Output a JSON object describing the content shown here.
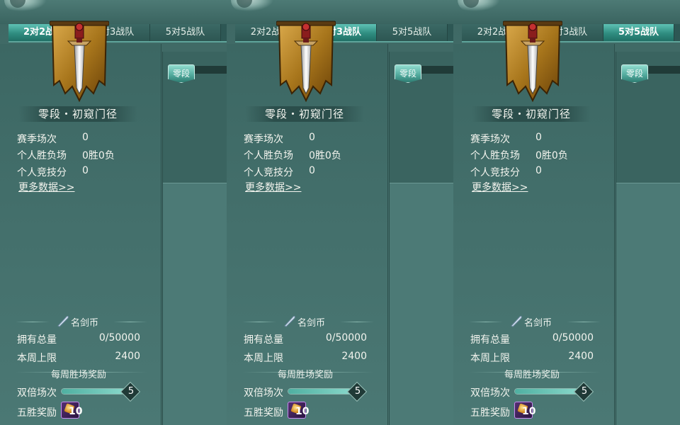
{
  "tabs": [
    "2对2战队",
    "3对3战队",
    "5对5战队"
  ],
  "panels": [
    {
      "active_tab": 0,
      "rank_badge": "零段",
      "rank_title": "零段・初窥门径",
      "stats": {
        "season_label": "赛季场次",
        "season_value": "0",
        "winloss_label": "个人胜负场",
        "winloss_value": "0胜0负",
        "score_label": "个人竞技分",
        "score_value": "0"
      },
      "more_data": "更多数据>>",
      "coin_section": "名剑币",
      "owned_label": "拥有总量",
      "owned_value": "0/50000",
      "weekly_cap_label": "本周上限",
      "weekly_cap_value": "2400",
      "weekly_reward_title": "每周胜场奖励",
      "double_label": "双倍场次",
      "double_value": "5",
      "double_progress": 1.0,
      "five_win_label": "五胜奖励",
      "five_win_value": "10"
    },
    {
      "active_tab": 1,
      "rank_badge": "零段",
      "rank_title": "零段・初窥门径",
      "stats": {
        "season_label": "赛季场次",
        "season_value": "0",
        "winloss_label": "个人胜负场",
        "winloss_value": "0胜0负",
        "score_label": "个人竞技分",
        "score_value": "0"
      },
      "more_data": "更多数据>>",
      "coin_section": "名剑币",
      "owned_label": "拥有总量",
      "owned_value": "0/50000",
      "weekly_cap_label": "本周上限",
      "weekly_cap_value": "2400",
      "weekly_reward_title": "每周胜场奖励",
      "double_label": "双倍场次",
      "double_value": "5",
      "double_progress": 1.0,
      "five_win_label": "五胜奖励",
      "five_win_value": "10"
    },
    {
      "active_tab": 2,
      "rank_badge": "零段",
      "rank_title": "零段・初窥门径",
      "stats": {
        "season_label": "赛季场次",
        "season_value": "0",
        "winloss_label": "个人胜负场",
        "winloss_value": "0胜0负",
        "score_label": "个人竞技分",
        "score_value": "0"
      },
      "more_data": "更多数据>>",
      "coin_section": "名剑币",
      "owned_label": "拥有总量",
      "owned_value": "0/50000",
      "weekly_cap_label": "本周上限",
      "weekly_cap_value": "2400",
      "weekly_reward_title": "每周胜场奖励",
      "double_label": "双倍场次",
      "double_value": "5",
      "double_progress": 1.0,
      "five_win_label": "五胜奖励",
      "five_win_value": "10"
    }
  ],
  "colors": {
    "active_tab": "#2f8d80",
    "panel_bg": "#44706c",
    "banner_gold": "#b5851f",
    "reward_border": "#c68bf0"
  },
  "icons": {
    "rank_emblem": "sword-banner-icon",
    "coin": "feather-blade-icon",
    "reward": "treasure-box-icon"
  }
}
